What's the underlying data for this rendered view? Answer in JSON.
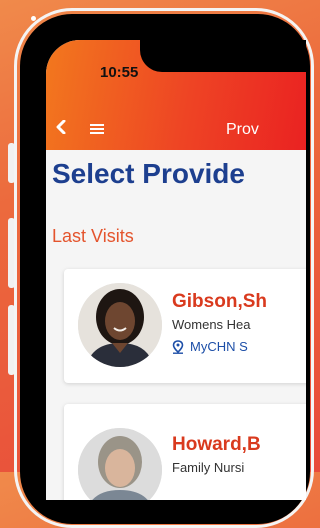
{
  "status_bar": {
    "time": "10:55"
  },
  "nav": {
    "title": "Prov"
  },
  "page": {
    "title": "Select Provide"
  },
  "section": {
    "title": "Last Visits"
  },
  "providers": [
    {
      "name": "Gibson,Sh",
      "specialty": "Womens Hea",
      "location": "MyCHN S"
    },
    {
      "name": "Howard,B",
      "specialty": "Family Nursi"
    }
  ],
  "colors": {
    "header_start": "#f2781e",
    "header_end": "#ea2222",
    "title_blue": "#1d3f8f",
    "accent_orange": "#e4542d",
    "provider_name": "#d93a1e",
    "link_blue": "#1d4fa8"
  },
  "icons": [
    "back-chevron-icon",
    "hamburger-menu-icon",
    "location-pin-icon"
  ]
}
